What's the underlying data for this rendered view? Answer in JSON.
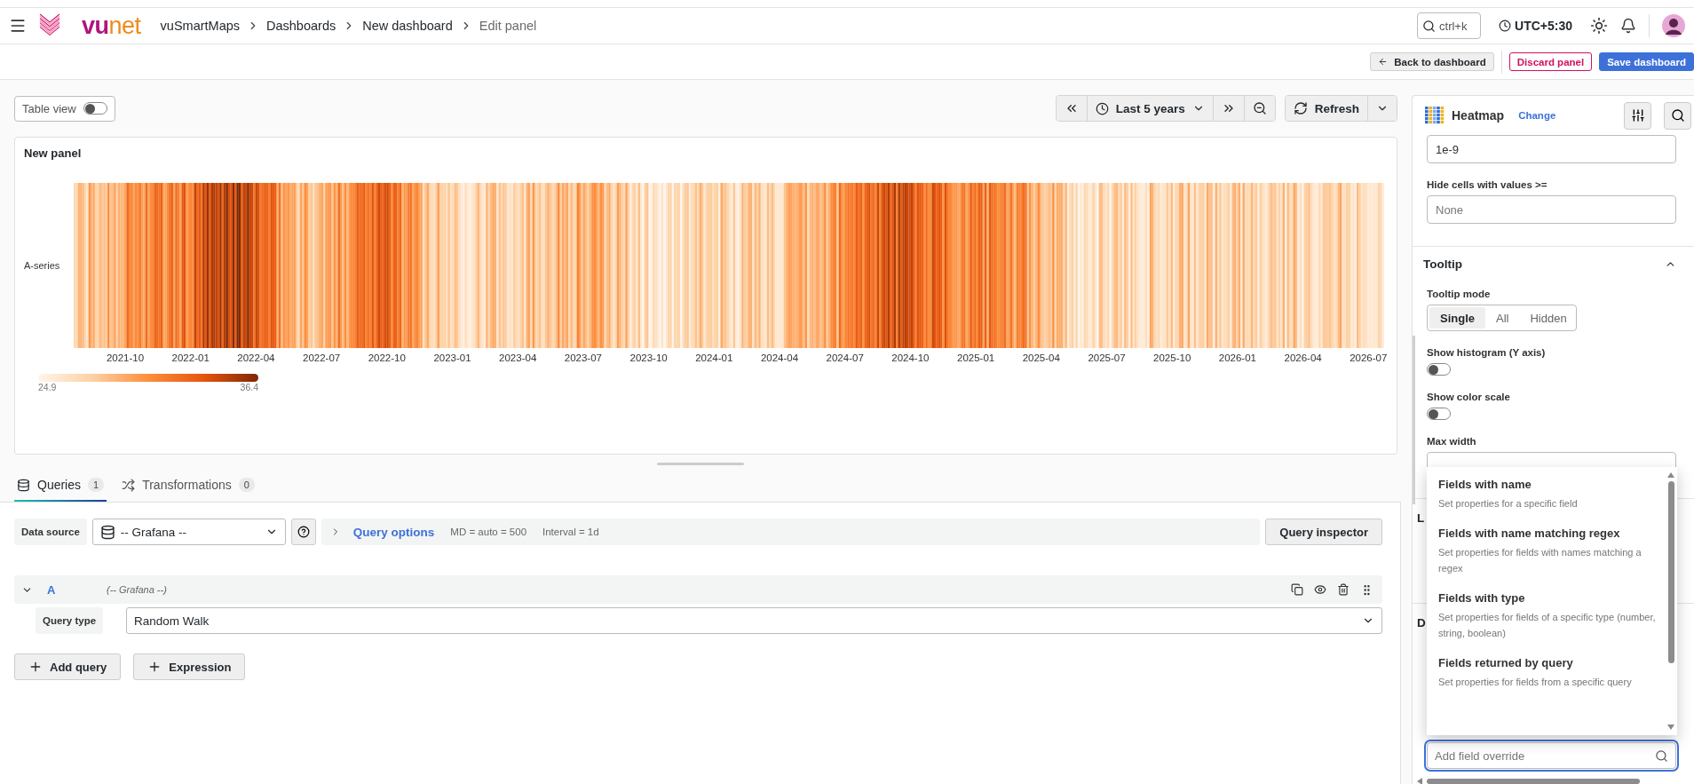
{
  "logo": {
    "parts": [
      "vu",
      "net"
    ]
  },
  "breadcrumbs": [
    {
      "label": "vuSmartMaps",
      "current": false
    },
    {
      "label": "Dashboards",
      "current": false
    },
    {
      "label": "New dashboard",
      "current": false
    },
    {
      "label": "Edit panel",
      "current": true
    }
  ],
  "search": {
    "placeholder": "ctrl+k"
  },
  "timezone": "UTC+5:30",
  "actions": [
    {
      "label": "Back to dashboard",
      "kind": "back"
    },
    {
      "label": "Discard panel",
      "kind": "danger"
    },
    {
      "label": "Save dashboard",
      "kind": "primary"
    }
  ],
  "table_view": {
    "label": "Table view",
    "on": false
  },
  "time_range": {
    "label": "Last 5 years"
  },
  "refresh": {
    "label": "Refresh"
  },
  "panel": {
    "title": "New panel",
    "series_label": "A-series",
    "x_ticks": [
      "2021-10",
      "2022-01",
      "2022-04",
      "2022-07",
      "2022-10",
      "2023-01",
      "2023-04",
      "2023-07",
      "2023-10",
      "2024-01",
      "2024-04",
      "2024-07",
      "2024-10",
      "2025-01",
      "2025-04",
      "2025-07",
      "2025-10",
      "2026-01",
      "2026-04",
      "2026-07"
    ],
    "legend": {
      "min": "24.9",
      "max": "36.4"
    }
  },
  "query_tabs": [
    {
      "label": "Queries",
      "count": "1",
      "selected": true
    },
    {
      "label": "Transformations",
      "count": "0",
      "selected": false
    }
  ],
  "data_source": {
    "label": "Data source",
    "value": "-- Grafana --",
    "options_label": "Query options",
    "max_data_points": "MD = auto = 500",
    "interval": "Interval = 1d",
    "inspector": "Query inspector"
  },
  "queries": [
    {
      "ref": "A",
      "source": "(-- Grafana --)",
      "expanded": true,
      "type_label": "Query type",
      "type_value": "Random Walk"
    }
  ],
  "query_buttons": [
    "Add query",
    "Expression"
  ],
  "options_pane": {
    "visualization": "Heatmap",
    "change": "Change",
    "min_value": "1e-9",
    "hide_label": "Hide cells with values >=",
    "hide_placeholder": "None",
    "tooltip": {
      "title": "Tooltip",
      "expanded": true,
      "mode_label": "Tooltip mode",
      "modes": [
        {
          "label": "Single",
          "selected": true
        },
        {
          "label": "All",
          "selected": false
        },
        {
          "label": "Hidden",
          "selected": false
        }
      ],
      "toggles": [
        {
          "label": "Show histogram (Y axis)",
          "on": false
        },
        {
          "label": "Show color scale",
          "on": false
        }
      ],
      "max_width_label": "Max width"
    },
    "covered_headings": [
      "L",
      "D"
    ],
    "override_field": {
      "placeholder": "Add field override"
    },
    "override_menu": [
      {
        "title": "Fields with name",
        "description": "Set properties for a specific field"
      },
      {
        "title": "Fields with name matching regex",
        "description": "Set properties for fields with names matching a regex"
      },
      {
        "title": "Fields with type",
        "description": "Set properties for fields of a specific type (number, string, boolean)"
      },
      {
        "title": "Fields returned by query",
        "description": "Set properties for fields from a specific query"
      }
    ]
  }
}
